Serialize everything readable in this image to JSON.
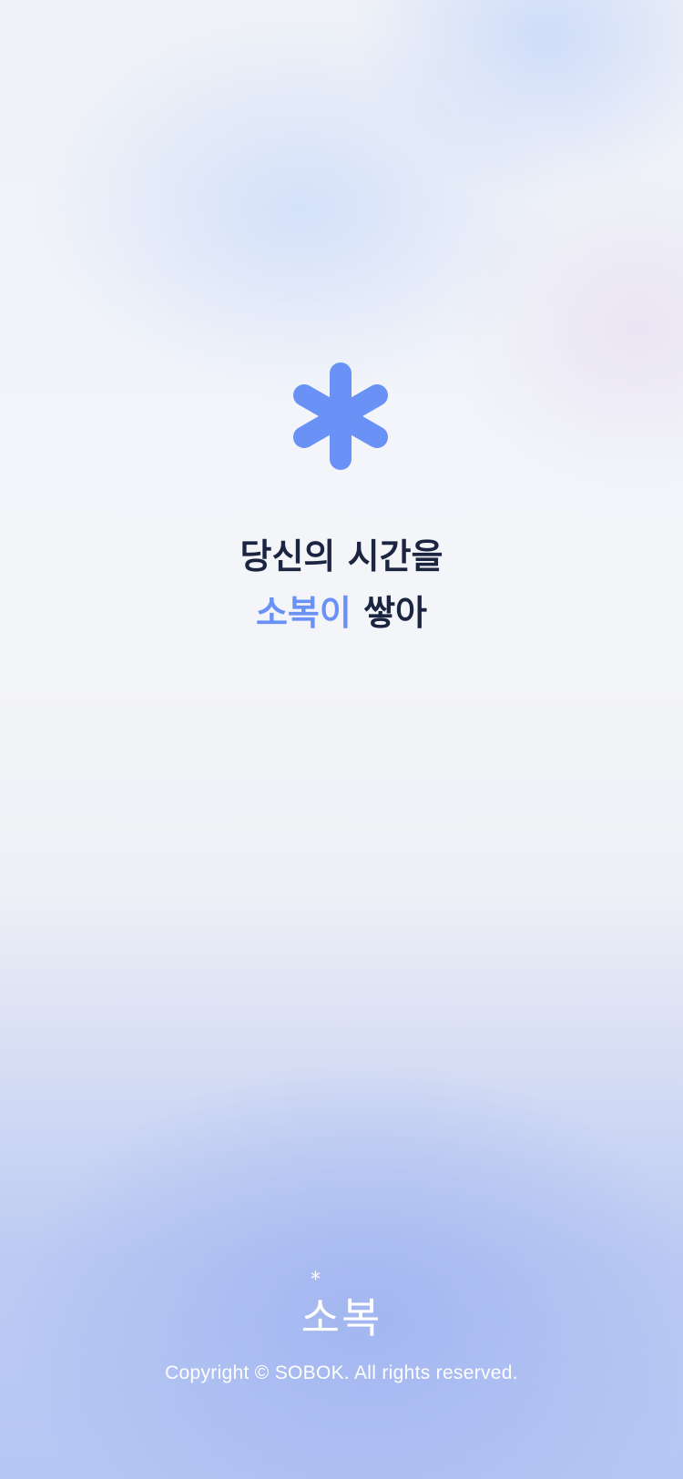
{
  "splash": {
    "headline_line1": "당신의 시간을",
    "headline_accent": "소복이",
    "headline_rest": " 쌓아",
    "accent_color": "#6a91f5",
    "icon": "asterisk-icon"
  },
  "footer": {
    "logo_text": "소복",
    "logo_mark": "*",
    "copyright": "Copyright © SOBOK. All rights reserved."
  }
}
